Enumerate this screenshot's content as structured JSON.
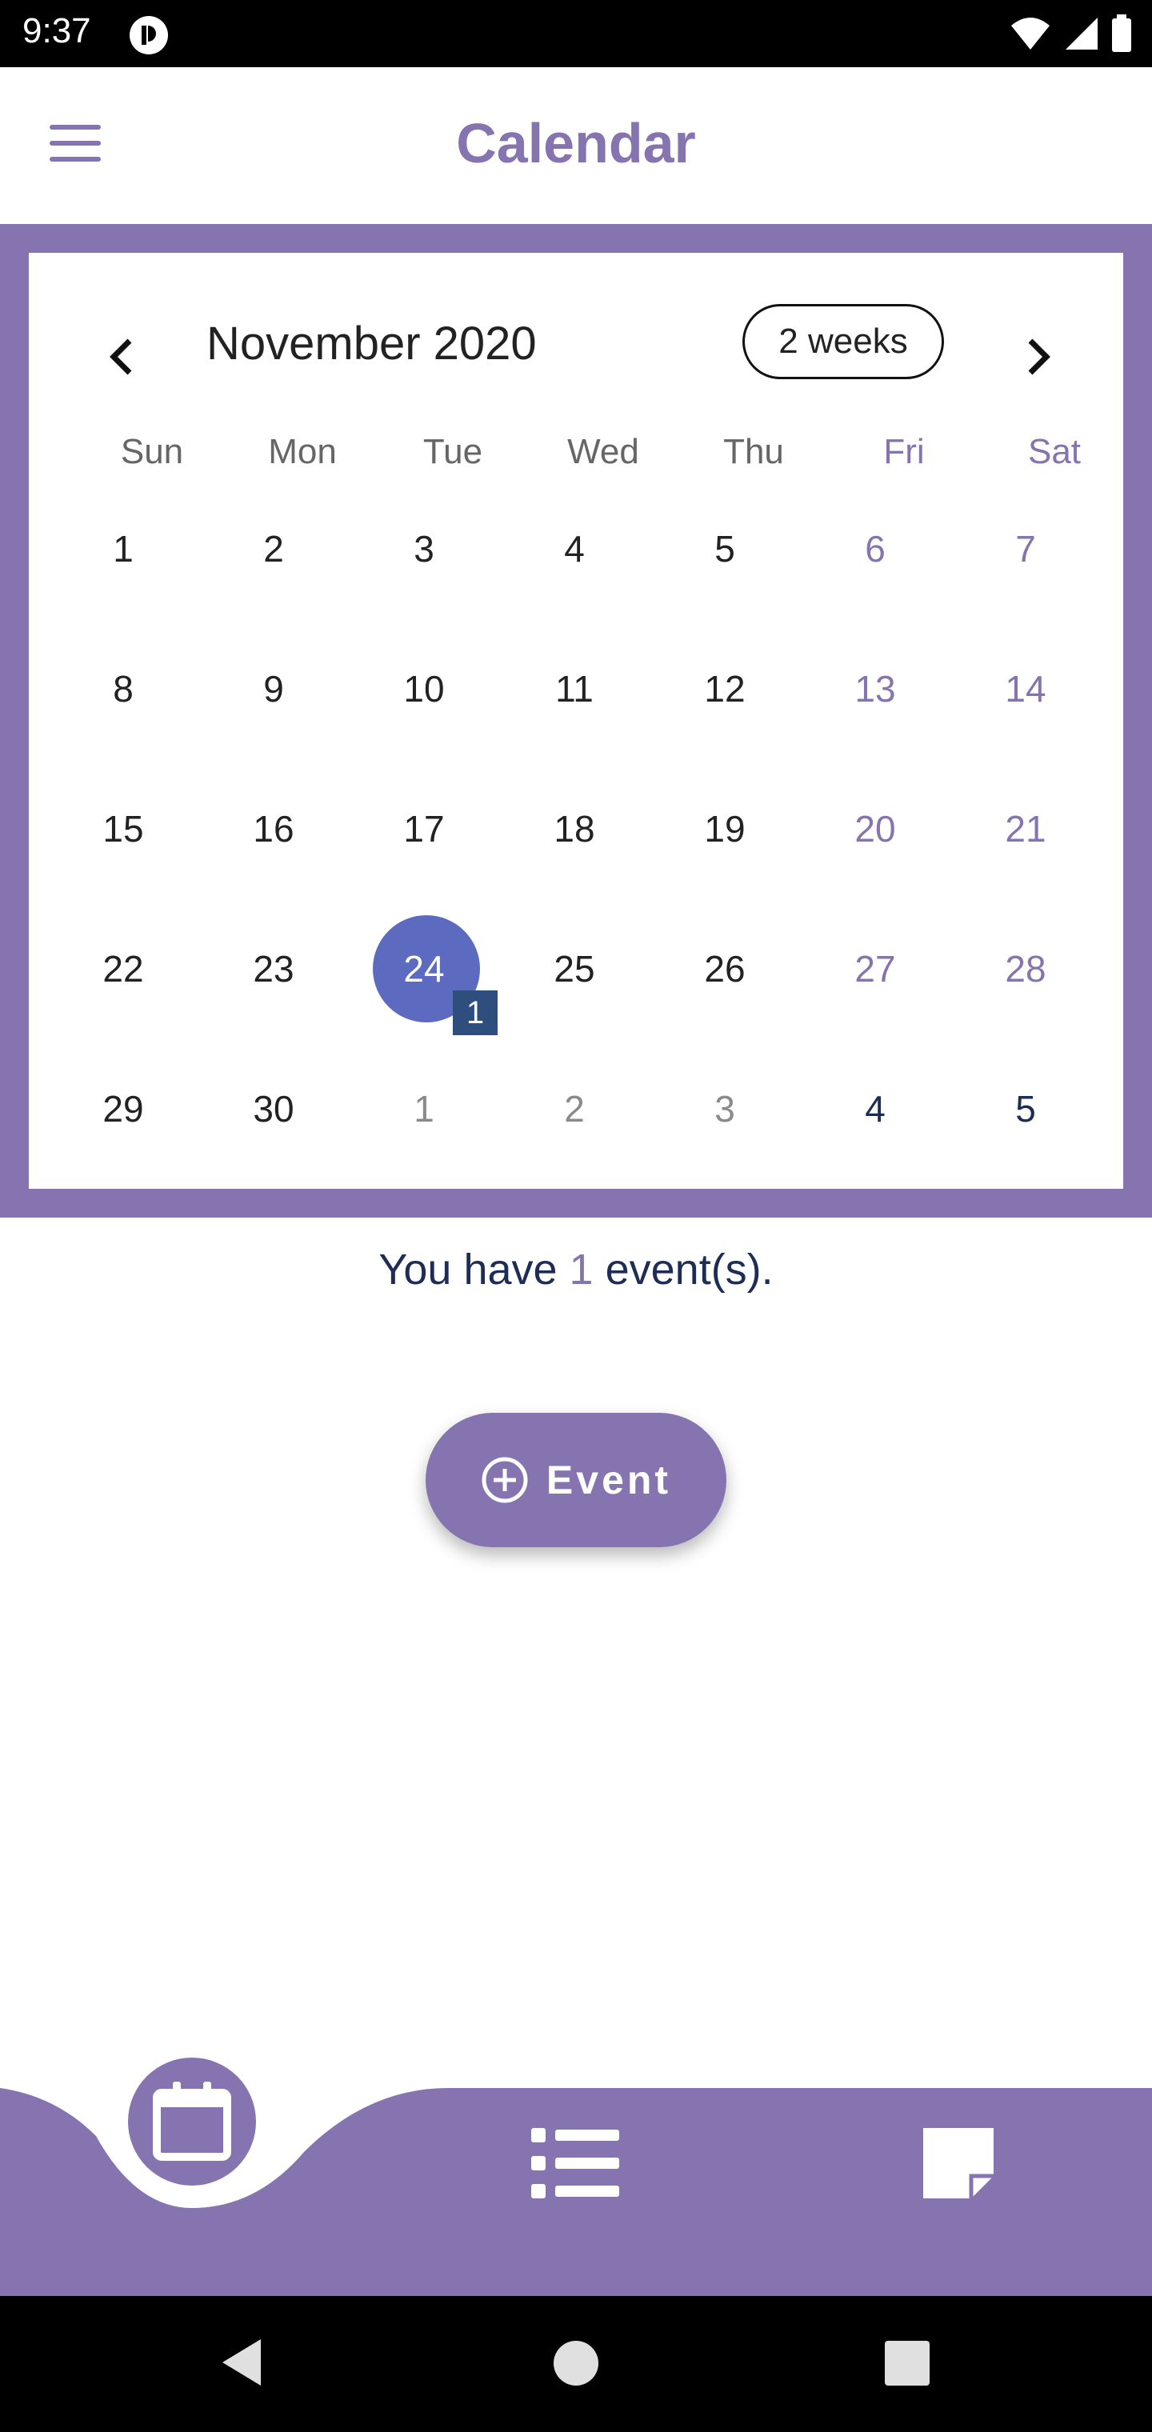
{
  "status_bar": {
    "time": "9:37"
  },
  "app_bar": {
    "title": "Calendar"
  },
  "calendar": {
    "month_title": "November 2020",
    "format_button": "2 weeks",
    "weekdays": [
      "Sun",
      "Mon",
      "Tue",
      "Wed",
      "Thu",
      "Fri",
      "Sat"
    ],
    "weeks": [
      [
        "1",
        "2",
        "3",
        "4",
        "5",
        "6",
        "7"
      ],
      [
        "8",
        "9",
        "10",
        "11",
        "12",
        "13",
        "14"
      ],
      [
        "15",
        "16",
        "17",
        "18",
        "19",
        "20",
        "21"
      ],
      [
        "22",
        "23",
        "24",
        "25",
        "26",
        "27",
        "28"
      ],
      [
        "29",
        "30",
        "1",
        "2",
        "3",
        "4",
        "5"
      ]
    ],
    "selected_day": "24",
    "event_marker_count": "1"
  },
  "events_summary": {
    "prefix": "You have ",
    "count": "1",
    "suffix": " event(s)."
  },
  "add_event_button": {
    "label": "Event"
  },
  "colors": {
    "accent": "#8674b0",
    "selected": "#5c6bc0",
    "marker": "#2e4e7e",
    "dark_text": "#1e2d55"
  }
}
